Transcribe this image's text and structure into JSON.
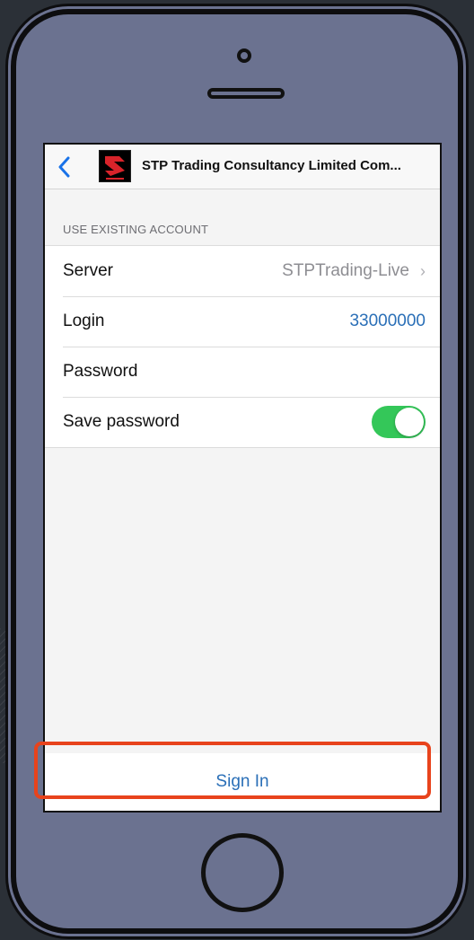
{
  "navbar": {
    "title": "STP Trading Consultancy Limited Com...",
    "back_icon": "chevron-left-icon",
    "logo_icon": "stp-logo-icon"
  },
  "section": {
    "header": "USE EXISTING ACCOUNT"
  },
  "rows": [
    {
      "label": "Server",
      "value": "STPTrading-Live",
      "accessory": "chevron-right-icon"
    },
    {
      "label": "Login",
      "value": "33000000"
    },
    {
      "label": "Password",
      "value": ""
    },
    {
      "label": "Save password",
      "toggle_on": true
    }
  ],
  "sign_in": {
    "label": "Sign In"
  },
  "colors": {
    "accent_blue": "#2a6fb7",
    "toggle_green": "#34c759",
    "highlight_red": "#e8431c",
    "phone_body": "#6b7290"
  }
}
